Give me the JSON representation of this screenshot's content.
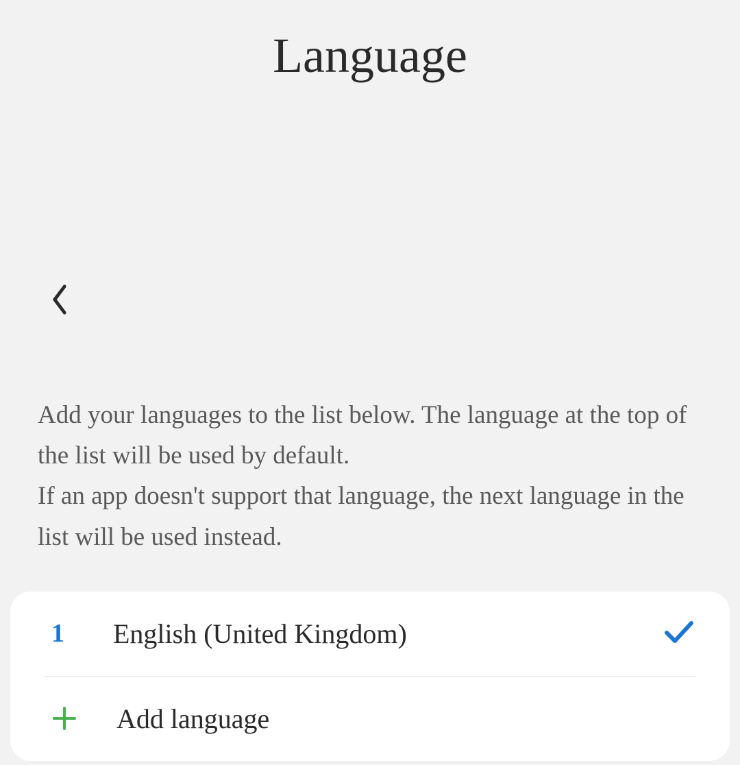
{
  "header": {
    "title": "Language"
  },
  "description": {
    "text": "Add your languages to the list below. The language at the top of the list will be used by default.\nIf an app doesn't support that language, the next language in the list will be used instead."
  },
  "languages": {
    "items": [
      {
        "rank": "1",
        "name": "English (United Kingdom)",
        "selected": true
      }
    ],
    "add_label": "Add language"
  }
}
